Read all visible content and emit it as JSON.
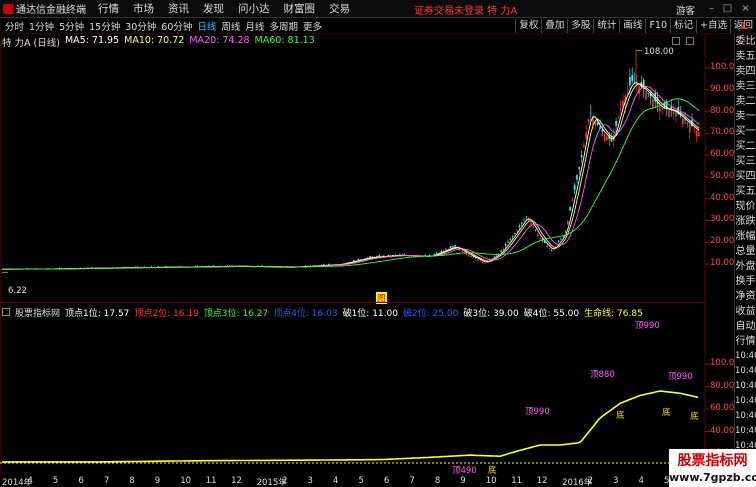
{
  "titlebar": {
    "app_name": "通达信金融终端",
    "menus": [
      "行情",
      "市场",
      "资讯",
      "发现",
      "问小达",
      "财富圈",
      "交易"
    ],
    "notice": "证券交易未登录  特 力A",
    "guest": "游客"
  },
  "toolbar": {
    "periods": [
      "分时",
      "1分钟",
      "5分钟",
      "15分钟",
      "30分钟",
      "60分钟",
      "日线",
      "周线",
      "月线",
      "多周期",
      "更多"
    ],
    "active_period": "日线",
    "right_buttons": [
      "复权",
      "叠加",
      "多股",
      "统计",
      "画线",
      "F10",
      "标记",
      "+自选",
      "返回"
    ]
  },
  "main_chart": {
    "stock_label": "特 力A (日线)",
    "ma": [
      {
        "label": "MA5: 71.95",
        "color": "#ffffff"
      },
      {
        "label": "MA10: 70.72",
        "color": "#ffff55"
      },
      {
        "label": "MA20: 74.28",
        "color": "#ff55ff"
      },
      {
        "label": "MA60: 81.13",
        "color": "#33ff33"
      }
    ],
    "price_ticks": [
      "100.0",
      "90.00",
      "80.00",
      "70.00",
      "60.00",
      "50.00",
      "40.00",
      "30.00",
      "20.00",
      "10.00"
    ],
    "high_label": "108.00",
    "low_label": "6.22",
    "mark_label": "图"
  },
  "sub_chart": {
    "name": "股票指标网",
    "items": [
      {
        "label": "顶点1位: 17.57",
        "color": "#ffffff"
      },
      {
        "label": "顶点2位: 16.19",
        "color": "#ff3333"
      },
      {
        "label": "顶点3位: 16.27",
        "color": "#33ff33"
      },
      {
        "label": "顶点4位: 16.03",
        "color": "#3355ff"
      },
      {
        "label": "破1位: 11.00",
        "color": "#ffffff"
      },
      {
        "label": "破2位: 25.00",
        "color": "#3355ff"
      },
      {
        "label": "破3位: 39.00",
        "color": "#ffffff"
      },
      {
        "label": "破4位: 55.00",
        "color": "#ffffff"
      },
      {
        "label": "生命线: 76.85",
        "color": "#ffff33"
      }
    ],
    "ticks": [
      "100.0",
      "80.00",
      "60.00",
      "40.00",
      "20.00"
    ],
    "annotations": [
      "顶990",
      "顶880",
      "顶990",
      "顶990",
      "顶490",
      "底",
      "底",
      "底",
      "底"
    ]
  },
  "side_panel": {
    "top": "L",
    "items": [
      "委比",
      "卖五",
      "卖四",
      "卖三",
      "卖二",
      "卖一",
      "买一",
      "买二",
      "买三",
      "买四",
      "买五",
      "现价",
      "涨跌",
      "涨幅",
      "总量",
      "外盘",
      "换手",
      "净资",
      "收益",
      "自动",
      "行情"
    ],
    "times": [
      "10:40",
      "10:40",
      "10:40",
      "10:40",
      "10:40",
      "10:40",
      "10:40",
      "10:40",
      "10:40"
    ]
  },
  "date_axis": {
    "labels": [
      "2014年",
      "4",
      "5",
      "6",
      "7",
      "8",
      "9",
      "10",
      "11",
      "12",
      "2015年",
      "2",
      "3",
      "4",
      "5",
      "6",
      "7",
      "8",
      "9",
      "10",
      "11",
      "12",
      "2016年",
      "2",
      "3",
      "4",
      "5"
    ]
  },
  "watermark": {
    "title": "股票指标网",
    "url": "www.7gpzb.com"
  },
  "colors": {
    "background": "#000000",
    "up_candle": "#ff3333",
    "down_candle": "#33ffff",
    "ma5": "#ffffff",
    "ma10": "#ffff55",
    "ma20": "#ff55ff",
    "ma60": "#33ff33",
    "life_line": "#ffff33"
  }
}
